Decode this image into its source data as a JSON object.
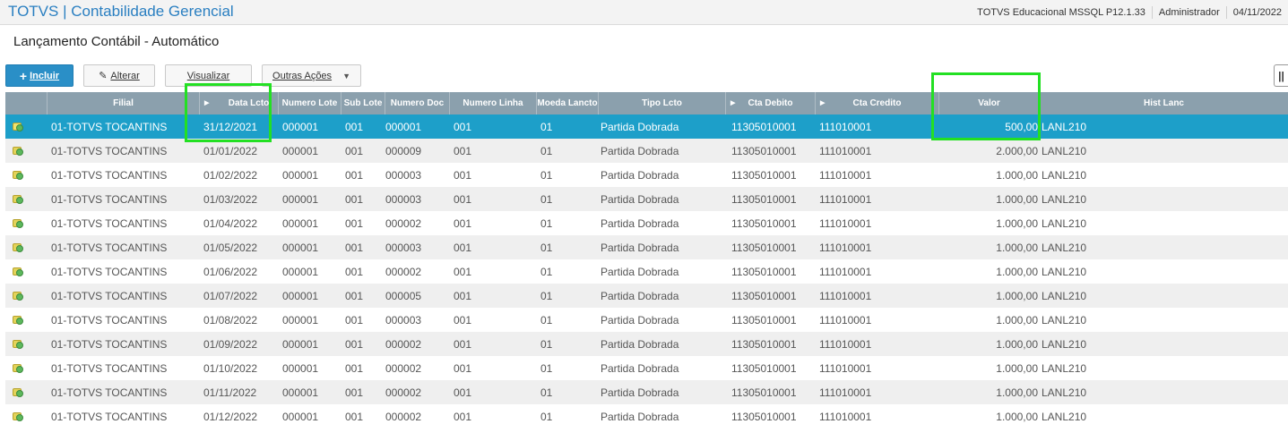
{
  "header": {
    "app_title": "TOTVS | Contabilidade Gerencial",
    "environment": "TOTVS Educacional MSSQL P12.1.33",
    "user": "Administrador",
    "date": "04/11/2022"
  },
  "page": {
    "title": "Lançamento Contábil - Automático"
  },
  "toolbar": {
    "incluir": "Incluir",
    "alterar": "Alterar",
    "visualizar": "Visualizar",
    "outras_acoes": "Outras Ações"
  },
  "columns": {
    "filial": "Filial",
    "data_lcto": "Data Lcto",
    "numero_lote": "Numero Lote",
    "sub_lote": "Sub Lote",
    "numero_doc": "Numero Doc",
    "numero_linha": "Numero Linha",
    "moeda_lancto": "Moeda Lancto",
    "tipo_lcto": "Tipo Lcto",
    "cta_debito": "Cta Debito",
    "cta_credito": "Cta Credito",
    "valor": "Valor",
    "hist_lanc": "Hist Lanc"
  },
  "rows": [
    {
      "filial": "01-TOTVS TOCANTINS",
      "data": "31/12/2021",
      "lote": "000001",
      "sublote": "001",
      "doc": "000001",
      "linha": "001",
      "moeda": "01",
      "tipo": "Partida Dobrada",
      "debito": "11305010001",
      "credito": "111010001",
      "valor": "500,00",
      "hist": "LANL210"
    },
    {
      "filial": "01-TOTVS TOCANTINS",
      "data": "01/01/2022",
      "lote": "000001",
      "sublote": "001",
      "doc": "000009",
      "linha": "001",
      "moeda": "01",
      "tipo": "Partida Dobrada",
      "debito": "11305010001",
      "credito": "111010001",
      "valor": "2.000,00",
      "hist": "LANL210"
    },
    {
      "filial": "01-TOTVS TOCANTINS",
      "data": "01/02/2022",
      "lote": "000001",
      "sublote": "001",
      "doc": "000003",
      "linha": "001",
      "moeda": "01",
      "tipo": "Partida Dobrada",
      "debito": "11305010001",
      "credito": "111010001",
      "valor": "1.000,00",
      "hist": "LANL210"
    },
    {
      "filial": "01-TOTVS TOCANTINS",
      "data": "01/03/2022",
      "lote": "000001",
      "sublote": "001",
      "doc": "000003",
      "linha": "001",
      "moeda": "01",
      "tipo": "Partida Dobrada",
      "debito": "11305010001",
      "credito": "111010001",
      "valor": "1.000,00",
      "hist": "LANL210"
    },
    {
      "filial": "01-TOTVS TOCANTINS",
      "data": "01/04/2022",
      "lote": "000001",
      "sublote": "001",
      "doc": "000002",
      "linha": "001",
      "moeda": "01",
      "tipo": "Partida Dobrada",
      "debito": "11305010001",
      "credito": "111010001",
      "valor": "1.000,00",
      "hist": "LANL210"
    },
    {
      "filial": "01-TOTVS TOCANTINS",
      "data": "01/05/2022",
      "lote": "000001",
      "sublote": "001",
      "doc": "000003",
      "linha": "001",
      "moeda": "01",
      "tipo": "Partida Dobrada",
      "debito": "11305010001",
      "credito": "111010001",
      "valor": "1.000,00",
      "hist": "LANL210"
    },
    {
      "filial": "01-TOTVS TOCANTINS",
      "data": "01/06/2022",
      "lote": "000001",
      "sublote": "001",
      "doc": "000002",
      "linha": "001",
      "moeda": "01",
      "tipo": "Partida Dobrada",
      "debito": "11305010001",
      "credito": "111010001",
      "valor": "1.000,00",
      "hist": "LANL210"
    },
    {
      "filial": "01-TOTVS TOCANTINS",
      "data": "01/07/2022",
      "lote": "000001",
      "sublote": "001",
      "doc": "000005",
      "linha": "001",
      "moeda": "01",
      "tipo": "Partida Dobrada",
      "debito": "11305010001",
      "credito": "111010001",
      "valor": "1.000,00",
      "hist": "LANL210"
    },
    {
      "filial": "01-TOTVS TOCANTINS",
      "data": "01/08/2022",
      "lote": "000001",
      "sublote": "001",
      "doc": "000003",
      "linha": "001",
      "moeda": "01",
      "tipo": "Partida Dobrada",
      "debito": "11305010001",
      "credito": "111010001",
      "valor": "1.000,00",
      "hist": "LANL210"
    },
    {
      "filial": "01-TOTVS TOCANTINS",
      "data": "01/09/2022",
      "lote": "000001",
      "sublote": "001",
      "doc": "000002",
      "linha": "001",
      "moeda": "01",
      "tipo": "Partida Dobrada",
      "debito": "11305010001",
      "credito": "111010001",
      "valor": "1.000,00",
      "hist": "LANL210"
    },
    {
      "filial": "01-TOTVS TOCANTINS",
      "data": "01/10/2022",
      "lote": "000001",
      "sublote": "001",
      "doc": "000002",
      "linha": "001",
      "moeda": "01",
      "tipo": "Partida Dobrada",
      "debito": "11305010001",
      "credito": "111010001",
      "valor": "1.000,00",
      "hist": "LANL210"
    },
    {
      "filial": "01-TOTVS TOCANTINS",
      "data": "01/11/2022",
      "lote": "000001",
      "sublote": "001",
      "doc": "000002",
      "linha": "001",
      "moeda": "01",
      "tipo": "Partida Dobrada",
      "debito": "11305010001",
      "credito": "111010001",
      "valor": "1.000,00",
      "hist": "LANL210"
    },
    {
      "filial": "01-TOTVS TOCANTINS",
      "data": "01/12/2022",
      "lote": "000001",
      "sublote": "001",
      "doc": "000002",
      "linha": "001",
      "moeda": "01",
      "tipo": "Partida Dobrada",
      "debito": "11305010001",
      "credito": "111010001",
      "valor": "1.000,00",
      "hist": "LANL210"
    }
  ],
  "colors": {
    "brand": "#2a7fc1",
    "header_bg": "#8ba0ad",
    "selected_row": "#1d9fc9",
    "highlight": "#23e023"
  }
}
